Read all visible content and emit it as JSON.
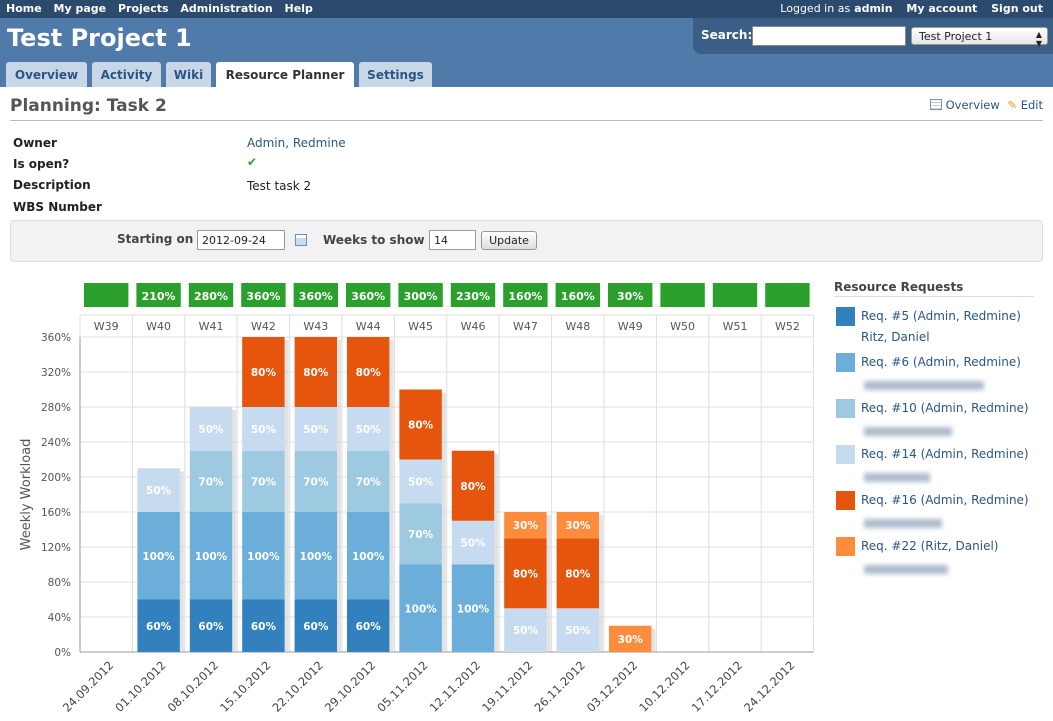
{
  "top_menu": {
    "left": [
      "Home",
      "My page",
      "Projects",
      "Administration",
      "Help"
    ],
    "logged_prefix": "Logged in as",
    "user": "admin",
    "my_account": "My account",
    "sign_out": "Sign out"
  },
  "header": {
    "title": "Test Project 1",
    "search_label": "Search:",
    "project_select": "Test Project 1",
    "tabs": [
      "Overview",
      "Activity",
      "Wiki",
      "Resource Planner",
      "Settings"
    ]
  },
  "page": {
    "heading": "Planning: Task 2",
    "overview": "Overview",
    "edit": "Edit",
    "attrs": {
      "owner_label": "Owner",
      "owner_value": "Admin, Redmine",
      "open_label": "Is open?",
      "open_value": "✔",
      "desc_label": "Description",
      "desc_value": "Test task 2",
      "wbs_label": "WBS Number"
    }
  },
  "filter": {
    "starting_label": "Starting on",
    "starting_value": "2012-09-24",
    "weeks_label": "Weeks to show",
    "weeks_value": "14",
    "update": "Update"
  },
  "legend": {
    "title": "Resource Requests",
    "items": [
      {
        "label": "Req. #5 (Admin, Redmine)",
        "sub": "Ritz, Daniel",
        "color": "#3380be"
      },
      {
        "label": "Req. #6 (Admin, Redmine)",
        "sub": "",
        "color": "#6aaed9"
      },
      {
        "label": "Req. #10 (Admin, Redmine)",
        "sub": "",
        "color": "#9ecae1"
      },
      {
        "label": "Req. #14 (Admin, Redmine)",
        "sub": "",
        "color": "#c6dbef"
      },
      {
        "label": "Req. #16 (Admin, Redmine)",
        "sub": "",
        "color": "#e6550d"
      },
      {
        "label": "Req. #22 (Ritz, Daniel)",
        "sub": "",
        "color": "#fd8d3c"
      }
    ]
  },
  "chart_data": {
    "type": "bar",
    "stacked": true,
    "ylabel": "Weekly Workload",
    "ylim": [
      0,
      360
    ],
    "yticks": [
      "0%",
      "40%",
      "80%",
      "120%",
      "160%",
      "200%",
      "240%",
      "280%",
      "320%",
      "360%"
    ],
    "weeks": [
      "W39",
      "W40",
      "W41",
      "W42",
      "W43",
      "W44",
      "W45",
      "W46",
      "W47",
      "W48",
      "W49",
      "W50",
      "W51",
      "W52"
    ],
    "categories": [
      "24.09.2012",
      "01.10.2012",
      "08.10.2012",
      "15.10.2012",
      "22.10.2012",
      "29.10.2012",
      "05.11.2012",
      "12.11.2012",
      "19.11.2012",
      "26.11.2012",
      "03.12.2012",
      "10.12.2012",
      "17.12.2012",
      "24.12.2012"
    ],
    "totals": [
      "",
      "210%",
      "280%",
      "360%",
      "360%",
      "360%",
      "300%",
      "230%",
      "160%",
      "160%",
      "30%",
      "",
      "",
      ""
    ],
    "series": [
      {
        "name": "Req. #5 (Admin, Redmine)",
        "color": "#3380be",
        "values": [
          0,
          60,
          60,
          60,
          60,
          60,
          0,
          0,
          0,
          0,
          0,
          0,
          0,
          0
        ]
      },
      {
        "name": "Req. #6 (Admin, Redmine)",
        "color": "#6aaed9",
        "values": [
          0,
          100,
          100,
          100,
          100,
          100,
          100,
          100,
          0,
          0,
          0,
          0,
          0,
          0
        ]
      },
      {
        "name": "Req. #10 (Admin, Redmine)",
        "color": "#9ecae1",
        "values": [
          0,
          0,
          70,
          70,
          70,
          70,
          70,
          0,
          0,
          0,
          0,
          0,
          0,
          0
        ]
      },
      {
        "name": "Req. #14 (Admin, Redmine)",
        "color": "#c6dbef",
        "values": [
          0,
          50,
          50,
          50,
          50,
          50,
          50,
          50,
          50,
          50,
          0,
          0,
          0,
          0
        ]
      },
      {
        "name": "Req. #16 (Admin, Redmine)",
        "color": "#e6550d",
        "values": [
          0,
          0,
          0,
          80,
          80,
          80,
          80,
          80,
          80,
          80,
          0,
          0,
          0,
          0
        ]
      },
      {
        "name": "Req. #22 (Ritz, Daniel)",
        "color": "#fd8d3c",
        "values": [
          0,
          0,
          0,
          0,
          0,
          0,
          0,
          0,
          30,
          30,
          30,
          0,
          0,
          0
        ]
      }
    ],
    "total_box_color": "#2ca02c",
    "grid": true
  }
}
